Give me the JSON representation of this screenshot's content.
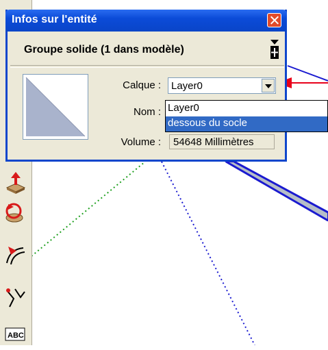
{
  "window": {
    "title": "Infos sur l'entité"
  },
  "entity": {
    "type_label": "Groupe solide (1 dans modèle)"
  },
  "fields": {
    "calque_label": "Calque :",
    "calque_value": "Layer0",
    "nom_label": "Nom :",
    "volume_label": "Volume :",
    "volume_value": "54648 Millimètres"
  },
  "dropdown": {
    "options": [
      "Layer0",
      "dessous du socle"
    ],
    "highlighted": "dessous du socle"
  },
  "toolbar": {
    "text_tool_label": "ABC"
  },
  "colors": {
    "title_bar": "#0b4bd8",
    "panel_bg": "#ece9d8",
    "selection": "#316ac5",
    "arrow": "#e8001a",
    "edge_blue": "#1a1ad0",
    "guide_green": "#1fa01f",
    "guide_blue": "#1a1ad0"
  }
}
